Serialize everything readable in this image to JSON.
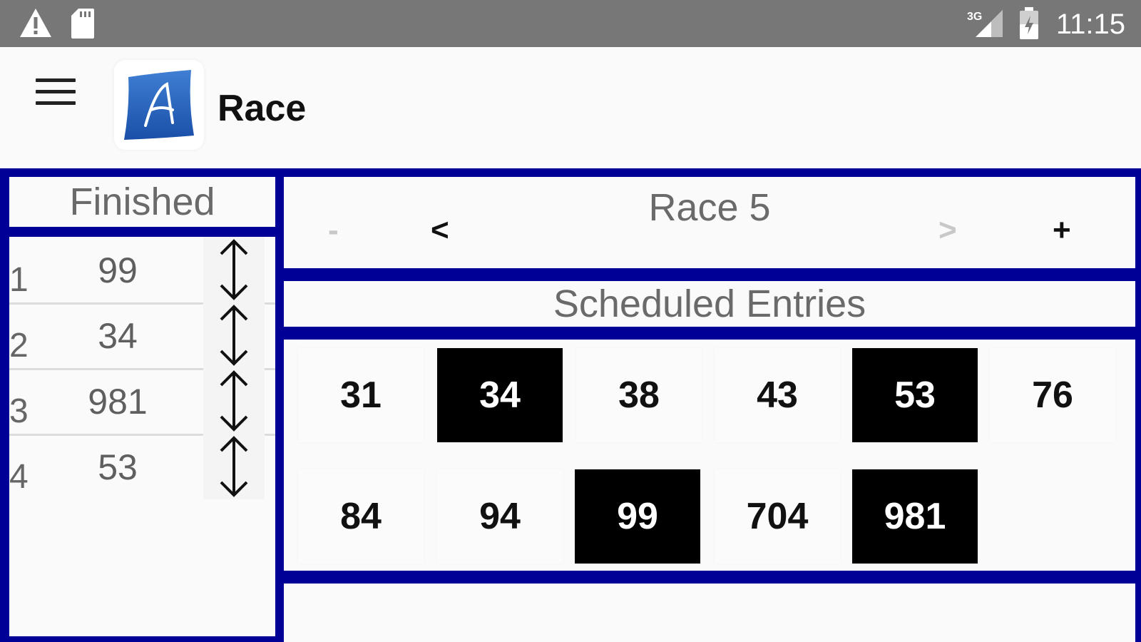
{
  "status_bar": {
    "time": "11:15",
    "network_label": "3G",
    "icons": [
      "warning-icon",
      "sd-card-icon",
      "signal-3g-icon",
      "battery-icon"
    ]
  },
  "app_bar": {
    "title": "Race",
    "menu_icon": "hamburger-menu-icon",
    "logo_letter": "A"
  },
  "finished": {
    "title": "Finished",
    "rows": [
      {
        "position": "1",
        "number": "99"
      },
      {
        "position": "2",
        "number": "34"
      },
      {
        "position": "3",
        "number": "981"
      },
      {
        "position": "4",
        "number": "53"
      }
    ]
  },
  "race_nav": {
    "title": "Race 5",
    "minus_label": "-",
    "prev_label": "<",
    "next_label": ">",
    "plus_label": "+"
  },
  "scheduled": {
    "title": "Scheduled Entries",
    "entries": [
      {
        "number": "31",
        "selected": false
      },
      {
        "number": "34",
        "selected": true
      },
      {
        "number": "38",
        "selected": false
      },
      {
        "number": "43",
        "selected": false
      },
      {
        "number": "53",
        "selected": true
      },
      {
        "number": "76",
        "selected": false
      },
      {
        "number": "84",
        "selected": false
      },
      {
        "number": "94",
        "selected": false
      },
      {
        "number": "99",
        "selected": true
      },
      {
        "number": "704",
        "selected": false
      },
      {
        "number": "981",
        "selected": true
      }
    ]
  },
  "colors": {
    "frame": "#000096",
    "status_bar": "#777777",
    "selected_bg": "#000000",
    "disabled_text": "#c8c8c8"
  }
}
